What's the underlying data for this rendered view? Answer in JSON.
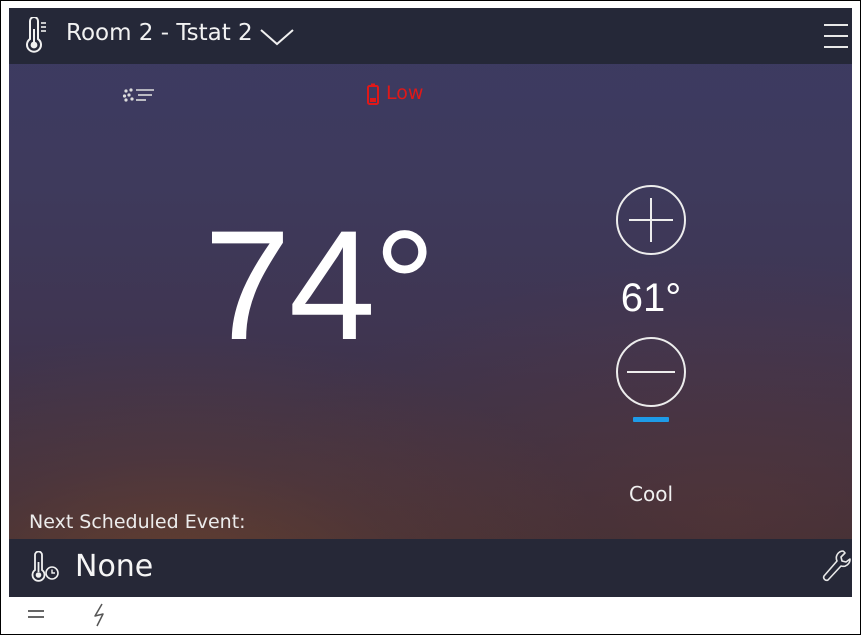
{
  "header": {
    "icon": "thermometer-icon",
    "title": "Room 2 - Tstat 2",
    "dropdown_icon": "chevron-down-icon",
    "menu_icon": "hamburger-menu-icon"
  },
  "status": {
    "fan_icon": "fan-icon",
    "battery_icon": "battery-low-icon",
    "battery_label": "Low",
    "battery_color": "#e01818"
  },
  "current_temperature": "74°",
  "setpoint": {
    "increase_icon": "plus-icon",
    "value": "61°",
    "decrease_icon": "minus-icon",
    "mode_indicator_color": "#1e9be8",
    "mode": "Cool"
  },
  "schedule": {
    "label": "Next Scheduled Event:",
    "icon": "thermometer-schedule-icon",
    "value": "None",
    "settings_icon": "wrench-icon"
  },
  "bottom_bar": {
    "icons": [
      "equals-icon",
      "lightning-icon"
    ]
  }
}
